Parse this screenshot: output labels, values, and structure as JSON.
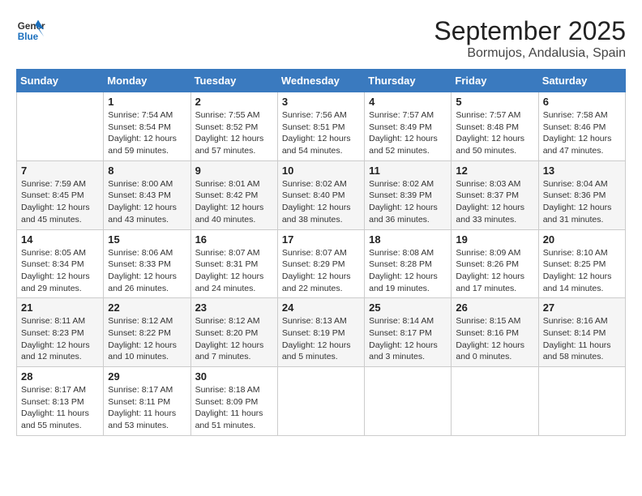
{
  "header": {
    "logo_line1": "General",
    "logo_line2": "Blue",
    "month": "September 2025",
    "location": "Bormujos, Andalusia, Spain"
  },
  "weekdays": [
    "Sunday",
    "Monday",
    "Tuesday",
    "Wednesday",
    "Thursday",
    "Friday",
    "Saturday"
  ],
  "weeks": [
    [
      {
        "day": "",
        "empty": true
      },
      {
        "day": "1",
        "sunrise": "7:54 AM",
        "sunset": "8:54 PM",
        "daylight": "12 hours and 59 minutes."
      },
      {
        "day": "2",
        "sunrise": "7:55 AM",
        "sunset": "8:52 PM",
        "daylight": "12 hours and 57 minutes."
      },
      {
        "day": "3",
        "sunrise": "7:56 AM",
        "sunset": "8:51 PM",
        "daylight": "12 hours and 54 minutes."
      },
      {
        "day": "4",
        "sunrise": "7:57 AM",
        "sunset": "8:49 PM",
        "daylight": "12 hours and 52 minutes."
      },
      {
        "day": "5",
        "sunrise": "7:57 AM",
        "sunset": "8:48 PM",
        "daylight": "12 hours and 50 minutes."
      },
      {
        "day": "6",
        "sunrise": "7:58 AM",
        "sunset": "8:46 PM",
        "daylight": "12 hours and 47 minutes."
      }
    ],
    [
      {
        "day": "7",
        "sunrise": "7:59 AM",
        "sunset": "8:45 PM",
        "daylight": "12 hours and 45 minutes."
      },
      {
        "day": "8",
        "sunrise": "8:00 AM",
        "sunset": "8:43 PM",
        "daylight": "12 hours and 43 minutes."
      },
      {
        "day": "9",
        "sunrise": "8:01 AM",
        "sunset": "8:42 PM",
        "daylight": "12 hours and 40 minutes."
      },
      {
        "day": "10",
        "sunrise": "8:02 AM",
        "sunset": "8:40 PM",
        "daylight": "12 hours and 38 minutes."
      },
      {
        "day": "11",
        "sunrise": "8:02 AM",
        "sunset": "8:39 PM",
        "daylight": "12 hours and 36 minutes."
      },
      {
        "day": "12",
        "sunrise": "8:03 AM",
        "sunset": "8:37 PM",
        "daylight": "12 hours and 33 minutes."
      },
      {
        "day": "13",
        "sunrise": "8:04 AM",
        "sunset": "8:36 PM",
        "daylight": "12 hours and 31 minutes."
      }
    ],
    [
      {
        "day": "14",
        "sunrise": "8:05 AM",
        "sunset": "8:34 PM",
        "daylight": "12 hours and 29 minutes."
      },
      {
        "day": "15",
        "sunrise": "8:06 AM",
        "sunset": "8:33 PM",
        "daylight": "12 hours and 26 minutes."
      },
      {
        "day": "16",
        "sunrise": "8:07 AM",
        "sunset": "8:31 PM",
        "daylight": "12 hours and 24 minutes."
      },
      {
        "day": "17",
        "sunrise": "8:07 AM",
        "sunset": "8:29 PM",
        "daylight": "12 hours and 22 minutes."
      },
      {
        "day": "18",
        "sunrise": "8:08 AM",
        "sunset": "8:28 PM",
        "daylight": "12 hours and 19 minutes."
      },
      {
        "day": "19",
        "sunrise": "8:09 AM",
        "sunset": "8:26 PM",
        "daylight": "12 hours and 17 minutes."
      },
      {
        "day": "20",
        "sunrise": "8:10 AM",
        "sunset": "8:25 PM",
        "daylight": "12 hours and 14 minutes."
      }
    ],
    [
      {
        "day": "21",
        "sunrise": "8:11 AM",
        "sunset": "8:23 PM",
        "daylight": "12 hours and 12 minutes."
      },
      {
        "day": "22",
        "sunrise": "8:12 AM",
        "sunset": "8:22 PM",
        "daylight": "12 hours and 10 minutes."
      },
      {
        "day": "23",
        "sunrise": "8:12 AM",
        "sunset": "8:20 PM",
        "daylight": "12 hours and 7 minutes."
      },
      {
        "day": "24",
        "sunrise": "8:13 AM",
        "sunset": "8:19 PM",
        "daylight": "12 hours and 5 minutes."
      },
      {
        "day": "25",
        "sunrise": "8:14 AM",
        "sunset": "8:17 PM",
        "daylight": "12 hours and 3 minutes."
      },
      {
        "day": "26",
        "sunrise": "8:15 AM",
        "sunset": "8:16 PM",
        "daylight": "12 hours and 0 minutes."
      },
      {
        "day": "27",
        "sunrise": "8:16 AM",
        "sunset": "8:14 PM",
        "daylight": "11 hours and 58 minutes."
      }
    ],
    [
      {
        "day": "28",
        "sunrise": "8:17 AM",
        "sunset": "8:13 PM",
        "daylight": "11 hours and 55 minutes."
      },
      {
        "day": "29",
        "sunrise": "8:17 AM",
        "sunset": "8:11 PM",
        "daylight": "11 hours and 53 minutes."
      },
      {
        "day": "30",
        "sunrise": "8:18 AM",
        "sunset": "8:09 PM",
        "daylight": "11 hours and 51 minutes."
      },
      {
        "day": "",
        "empty": true
      },
      {
        "day": "",
        "empty": true
      },
      {
        "day": "",
        "empty": true
      },
      {
        "day": "",
        "empty": true
      }
    ]
  ]
}
